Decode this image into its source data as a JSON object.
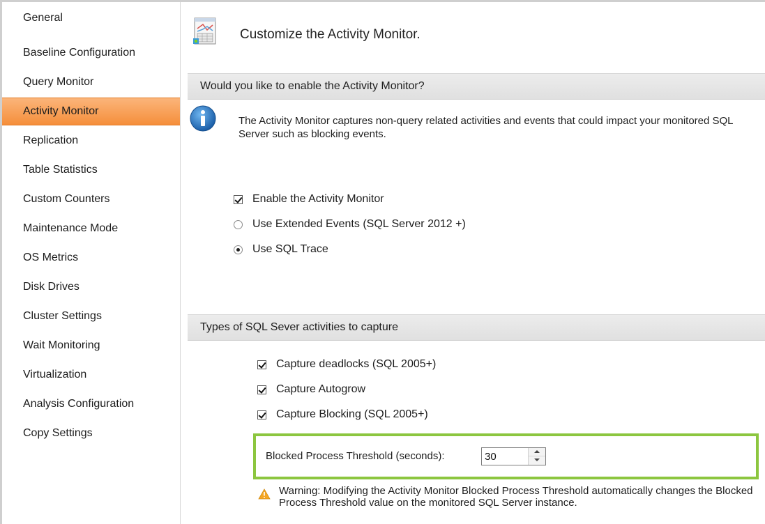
{
  "sidebar": {
    "items": [
      {
        "label": "General",
        "active": false
      },
      {
        "label": "Baseline Configuration",
        "active": false
      },
      {
        "label": "Query Monitor",
        "active": false
      },
      {
        "label": "Activity Monitor",
        "active": true
      },
      {
        "label": "Replication",
        "active": false
      },
      {
        "label": "Table Statistics",
        "active": false
      },
      {
        "label": "Custom Counters",
        "active": false
      },
      {
        "label": "Maintenance Mode",
        "active": false
      },
      {
        "label": "OS Metrics",
        "active": false
      },
      {
        "label": "Disk Drives",
        "active": false
      },
      {
        "label": "Cluster Settings",
        "active": false
      },
      {
        "label": "Wait Monitoring",
        "active": false
      },
      {
        "label": "Virtualization",
        "active": false
      },
      {
        "label": "Analysis Configuration",
        "active": false
      },
      {
        "label": "Copy Settings",
        "active": false
      }
    ],
    "active_color": "#f79a4d"
  },
  "header": {
    "title": "Customize the Activity Monitor.",
    "icon": "settings-document-icon"
  },
  "enable_section": {
    "title": "Would you like to enable the Activity Monitor?",
    "info_icon": "info-icon",
    "info_text": "The Activity Monitor captures non-query related activities and events that could impact your monitored SQL Server such as blocking events.",
    "enable_checkbox": {
      "label": "Enable the Activity Monitor",
      "checked": true
    },
    "source_options": [
      {
        "label": "Use Extended Events (SQL Server 2012 +)",
        "selected": false
      },
      {
        "label": "Use SQL Trace",
        "selected": true
      }
    ]
  },
  "capture_section": {
    "title": "Types of SQL Sever activities to capture",
    "options": [
      {
        "label": "Capture deadlocks (SQL 2005+)",
        "checked": true
      },
      {
        "label": "Capture Autogrow",
        "checked": true
      },
      {
        "label": "Capture Blocking (SQL 2005+)",
        "checked": true
      }
    ],
    "threshold": {
      "label": "Blocked Process Threshold (seconds):",
      "value": "30",
      "highlight_color": "#8cc63f"
    },
    "warning": {
      "icon": "warning-icon",
      "text": "Warning: Modifying the Activity Monitor Blocked Process Threshold automatically changes the Blocked Process Threshold value on the monitored SQL Server instance."
    }
  }
}
